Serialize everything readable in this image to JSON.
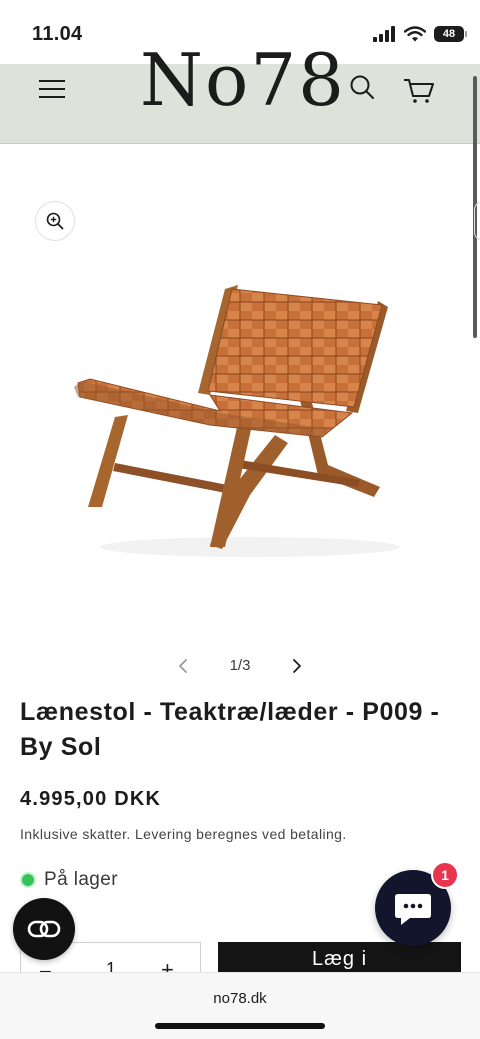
{
  "status_bar": {
    "time": "11.04",
    "battery": "48"
  },
  "header": {
    "logo": "No78"
  },
  "gallery": {
    "counter": "1/3"
  },
  "product": {
    "title": "Lænestol - Teaktræ/læder - P009 - By Sol",
    "price": "4.995,00 DKK",
    "tax_note": "Inklusive skatter. Levering beregnes ved betaling.",
    "stock_status": "På lager",
    "quantity": "1",
    "add_to_cart_label": "Læg i"
  },
  "chat": {
    "badge_count": "1"
  },
  "browser": {
    "url": "no78.dk"
  },
  "colors": {
    "header_bg": "#dfe1db",
    "in_stock": "#37c25a",
    "chat_bg": "#12152b",
    "badge": "#e8344e",
    "leather": "#c8703a",
    "teak": "#a0602e"
  }
}
